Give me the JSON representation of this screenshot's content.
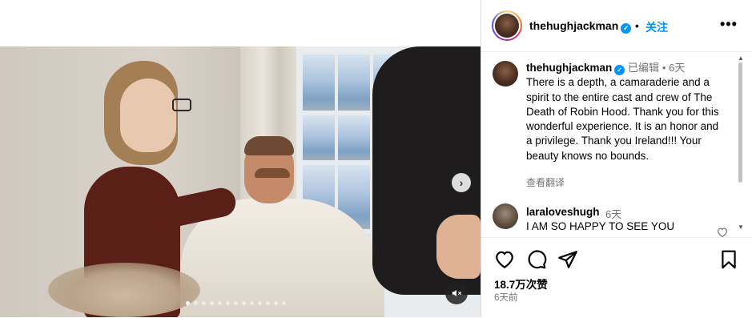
{
  "post": {
    "username": "thehughjackman",
    "follow_label": "关注",
    "header_separator": "•"
  },
  "caption": {
    "username": "thehughjackman",
    "edited_label": "已编辑",
    "separator": "•",
    "time": "6天",
    "text": "There is a depth, a camaraderie and a spirit to the entire cast and crew of The Death of Robin Hood. Thank you for this wonderful experience. It is an honor and a privilege. Thank you Ireland!!! Your beauty knows no bounds.",
    "translate_label": "查看翻译"
  },
  "comment": {
    "username": "laraloveshugh",
    "time": "6天",
    "text": "I AM SO HAPPY TO SEE YOU"
  },
  "stats": {
    "likes": "18.7万次赞",
    "posted_ago": "6天前"
  },
  "carousel": {
    "slide_count": 13,
    "active_index": 0
  },
  "icons": {
    "verified": "verified-badge-icon",
    "more": "more-options-icon",
    "like": "heart-icon",
    "comment": "comment-icon",
    "share": "paper-plane-icon",
    "save": "bookmark-icon",
    "next": "chevron-right-icon",
    "mute": "speaker-muted-icon"
  },
  "colors": {
    "accent": "#0095f6",
    "secondary_text": "#737373",
    "border": "#dbdbdb"
  }
}
